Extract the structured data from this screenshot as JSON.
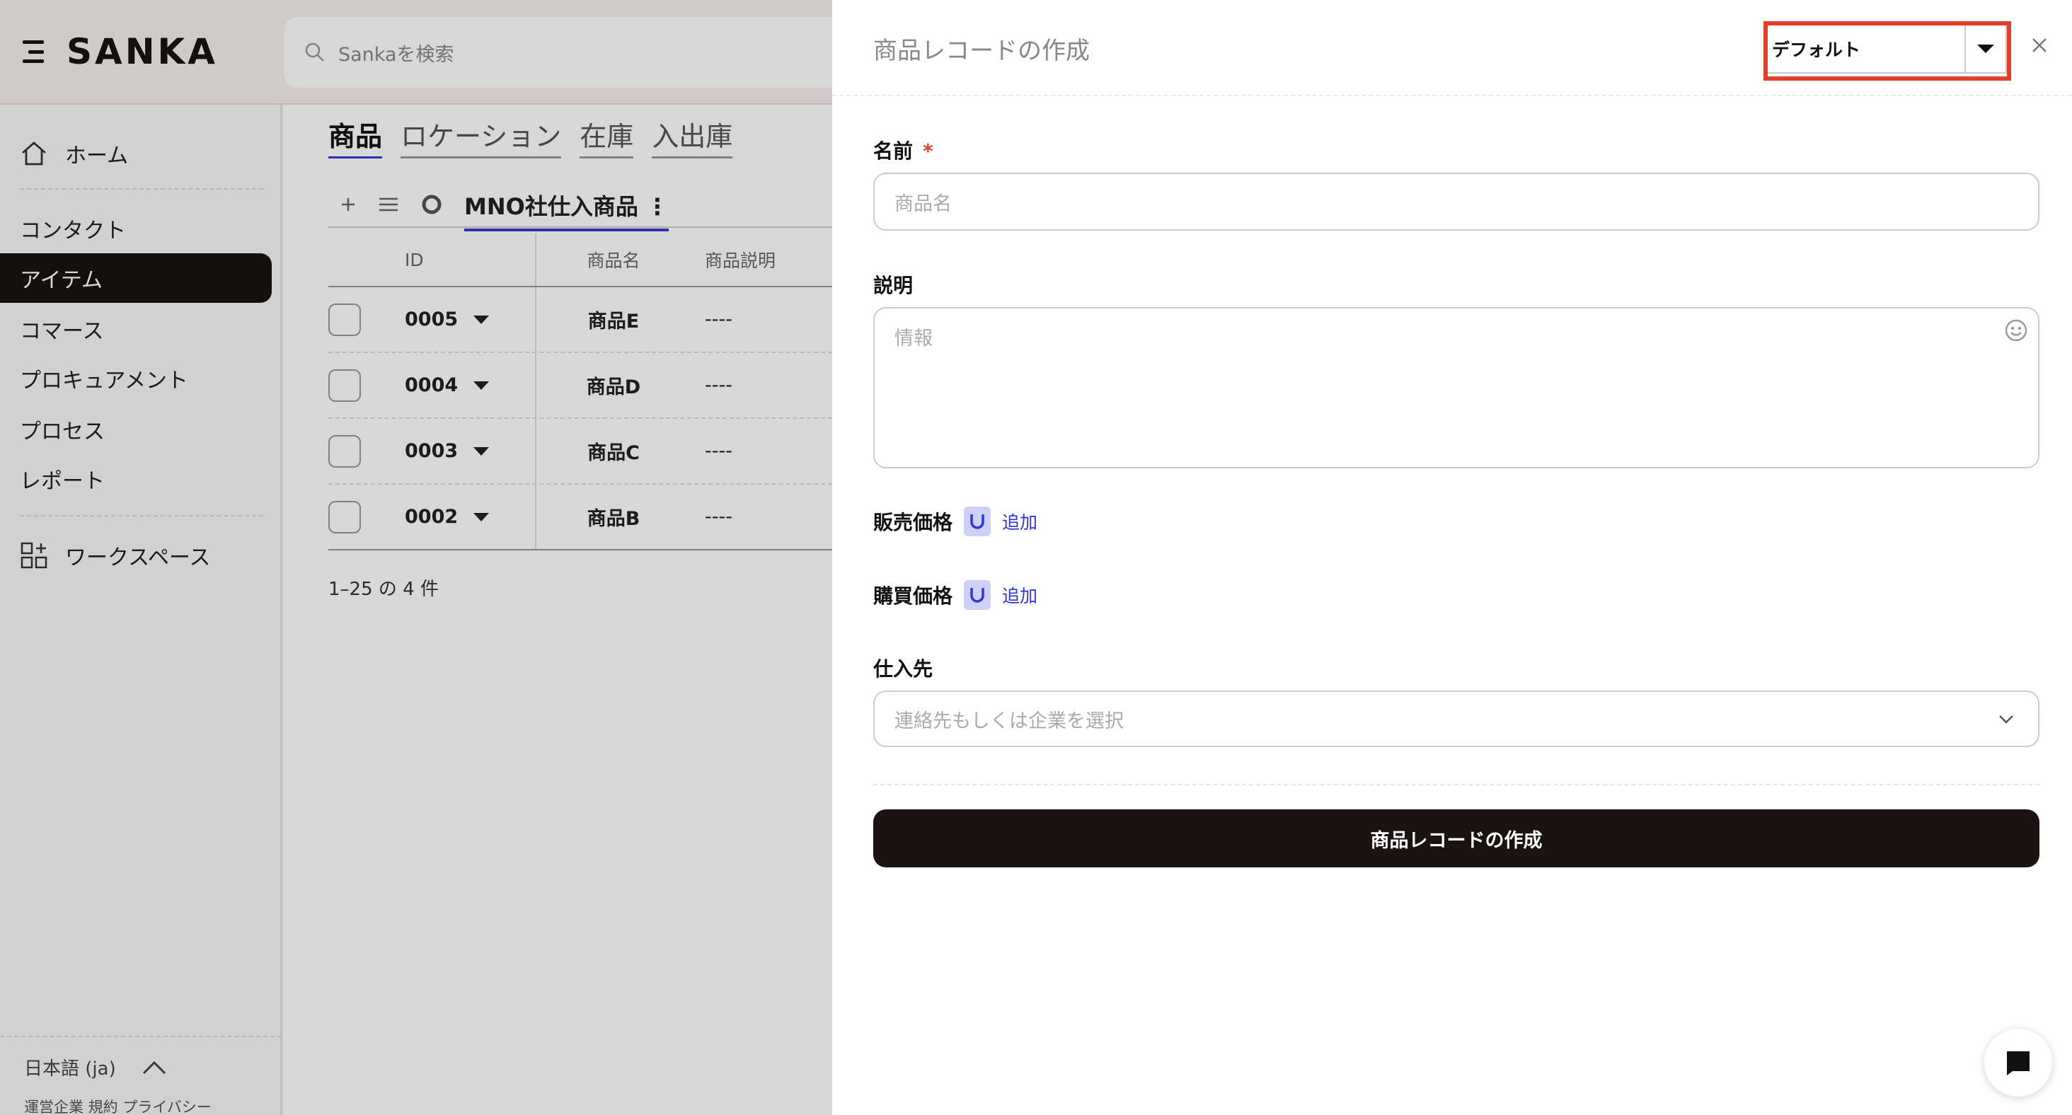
{
  "app": {
    "brand": "SANKA"
  },
  "search": {
    "placeholder": "Sankaを検索"
  },
  "sidebar": {
    "items": [
      {
        "label": "ホーム"
      },
      {
        "label": "コンタクト"
      },
      {
        "label": "アイテム"
      },
      {
        "label": "コマース"
      },
      {
        "label": "プロキュアメント"
      },
      {
        "label": "プロセス"
      },
      {
        "label": "レポート"
      },
      {
        "label": "ワークスペース"
      }
    ],
    "language": "日本語 (ja)",
    "footer_links": "運営企業 規約 プライバシー"
  },
  "content": {
    "tabs": [
      "商品",
      "ロケーション",
      "在庫",
      "入出庫"
    ],
    "view_name": "MNO社仕入商品",
    "columns": [
      "ID",
      "商品名",
      "商品説明"
    ],
    "rows": [
      {
        "id": "0005",
        "name": "商品E",
        "desc": "----"
      },
      {
        "id": "0004",
        "name": "商品D",
        "desc": "----"
      },
      {
        "id": "0003",
        "name": "商品C",
        "desc": "----"
      },
      {
        "id": "0002",
        "name": "商品B",
        "desc": "----"
      }
    ],
    "count_text": "1–25 の 4 件"
  },
  "drawer": {
    "title": "商品レコードの作成",
    "template_value": "デフォルト",
    "name_label": "名前",
    "required_mark": "*",
    "name_placeholder": "商品名",
    "desc_label": "説明",
    "desc_placeholder": "情報",
    "sale_price_label": "販売価格",
    "purchase_price_label": "購買価格",
    "add_label": "追加",
    "supplier_label": "仕入先",
    "supplier_placeholder": "連絡先もしくは企業を選択",
    "submit_label": "商品レコードの作成"
  },
  "colors": {
    "dark": "#1b1310",
    "accent": "#3b3bd1",
    "highlight": "#e0402a",
    "badge": "#cfd0f7"
  }
}
